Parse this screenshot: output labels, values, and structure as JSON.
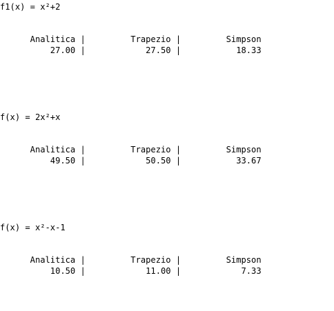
{
  "output_lines": [
    "f1(x) = x²+2",
    "      Analitica |         Trapezio |         Simpson",
    "          27.00 |            27.50 |           18.33",
    "f(x) = 2x²+x",
    "      Analitica |         Trapezio |         Simpson",
    "          49.50 |            50.50 |           33.67",
    "f(x) = x²-x-1",
    "      Analitica |         Trapezio |         Simpson",
    "          10.50 |            11.00 |            7.33"
  ]
}
